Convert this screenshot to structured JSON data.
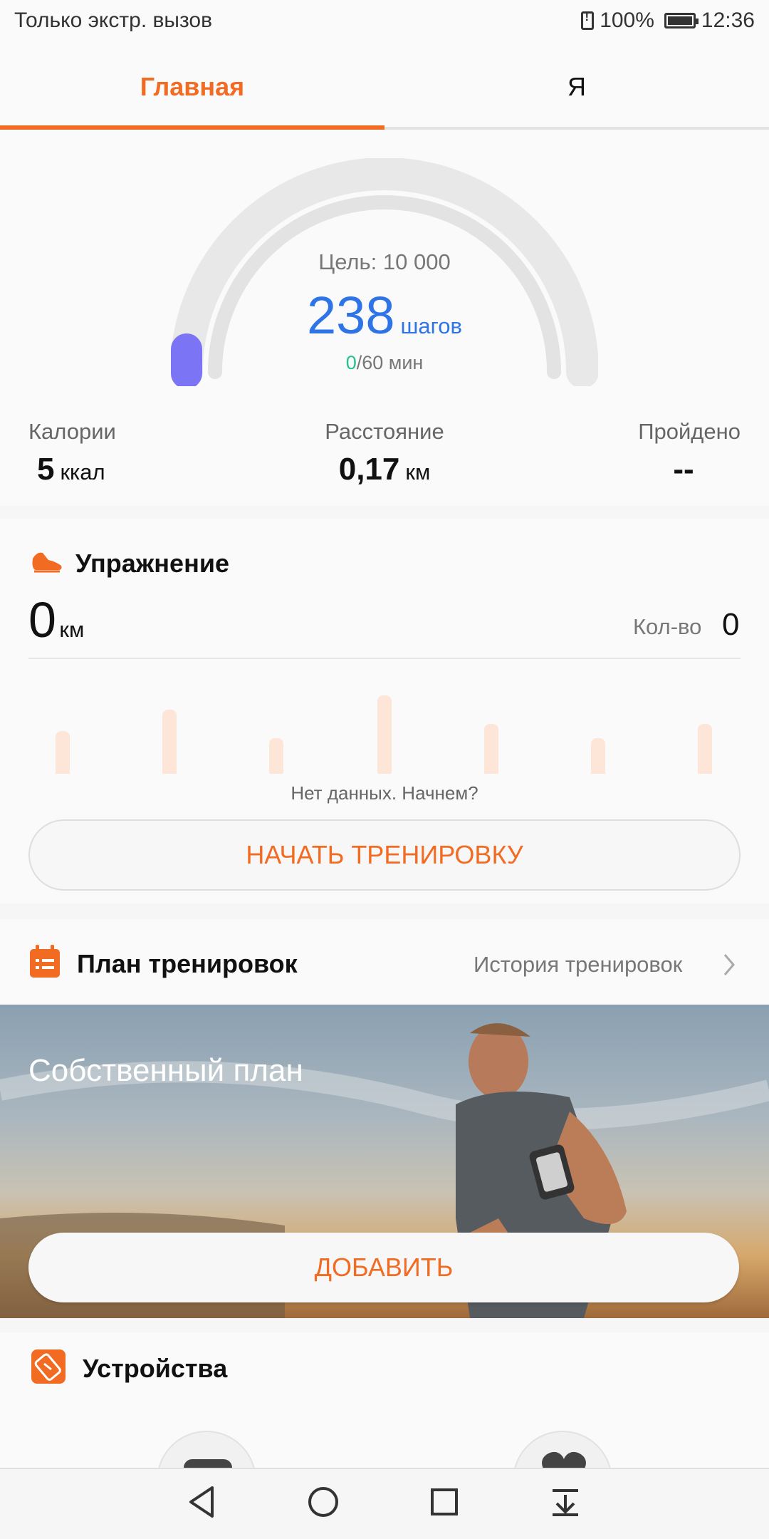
{
  "status_bar": {
    "left_text": "Только экстр. вызов",
    "battery": "100%",
    "time": "12:36"
  },
  "tabs": {
    "main": "Главная",
    "me": "Я"
  },
  "steps": {
    "goal_text": "Цель: 10 000",
    "count": "238",
    "unit": "шагов",
    "active_minutes": "0",
    "minutes_goal": "/60 мин",
    "goal_progress": 0.0238
  },
  "stats": {
    "calories": {
      "label": "Калории",
      "value": "5",
      "unit": "ккал"
    },
    "distance": {
      "label": "Расстояние",
      "value": "0,17",
      "unit": "км"
    },
    "climbed": {
      "label": "Пройдено",
      "value": "--"
    }
  },
  "exercise": {
    "title": "Упражнение",
    "distance_value": "0",
    "distance_unit": "км",
    "count_label": "Кол-во",
    "count_value": "0",
    "no_data": "Нет данных. Начнем?",
    "start_button": "НАЧАТЬ ТРЕНИРОВКУ"
  },
  "plan": {
    "title": "План тренировок",
    "history_link": "История тренировок",
    "banner_title": "Собственный план",
    "add_button": "ДОБАВИТЬ"
  },
  "devices": {
    "title": "Устройства"
  },
  "colors": {
    "accent": "#f26b23",
    "steps_blue": "#2f74e6",
    "minutes_green": "#25c28c",
    "gauge_marker": "#7b74f5"
  }
}
